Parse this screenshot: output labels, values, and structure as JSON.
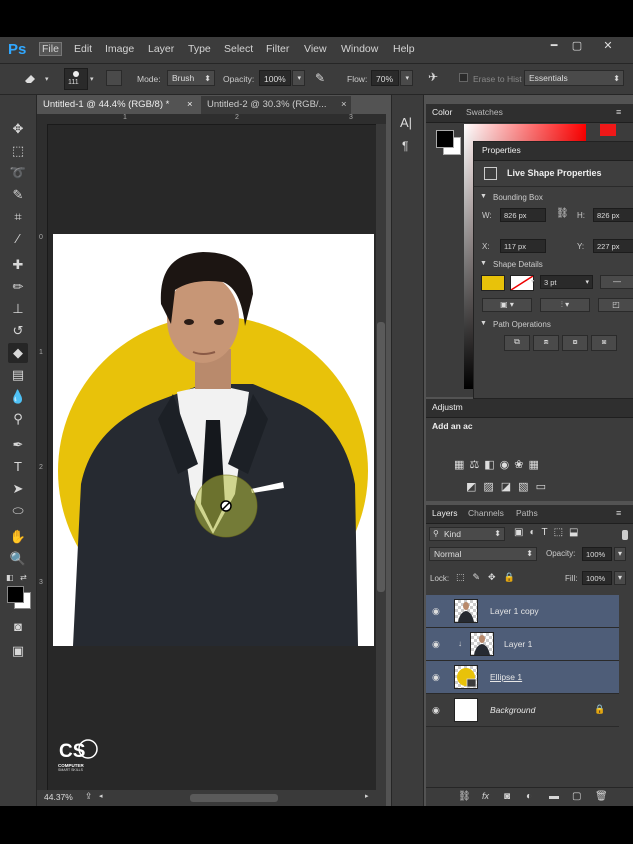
{
  "app": {
    "logo": "Ps"
  },
  "menu": [
    "File",
    "Edit",
    "Image",
    "Layer",
    "Type",
    "Select",
    "Filter",
    "View",
    "Window",
    "Help"
  ],
  "window_buttons": [
    "━",
    "▢",
    "✕"
  ],
  "options": {
    "brush_size": "111",
    "mode_label": "Mode:",
    "mode_value": "Brush",
    "opacity_label": "Opacity:",
    "opacity_value": "100%",
    "flow_label": "Flow:",
    "flow_value": "70%",
    "erase_label": "Erase to Hist",
    "workspace": "Essentials"
  },
  "tabs": [
    {
      "label": "Untitled-1 @ 44.4% (RGB/8) *",
      "close": "×"
    },
    {
      "label": "Untitled-2 @ 30.3% (RGB/...",
      "close": "×"
    }
  ],
  "rulers": {
    "top": [
      "1",
      "2",
      "3"
    ],
    "left": [
      "0",
      "1",
      "2",
      "3"
    ]
  },
  "status": {
    "zoom": "44.37%"
  },
  "watermark": {
    "line1": "COMPUTER",
    "line2": "SMART SKILLS"
  },
  "color_panel": {
    "tab_color": "Color",
    "tab_swatches": "Swatches"
  },
  "properties": {
    "tab": "Properties",
    "title": "Live Shape Properties",
    "bounding_box": "Bounding Box",
    "w_label": "W:",
    "w_value": "826 px",
    "h_label": "H:",
    "h_value": "826 px",
    "x_label": "X:",
    "x_value": "117 px",
    "y_label": "Y:",
    "y_value": "227 px",
    "shape_details": "Shape Details",
    "stroke_width": "3 pt",
    "path_operations": "Path Operations"
  },
  "adjustments": {
    "title": "Adjustm",
    "add": "Add an ac"
  },
  "layers_panel": {
    "tab_layers": "Layers",
    "tab_channels": "Channels",
    "tab_paths": "Paths",
    "kind": "Kind",
    "blend_mode": "Normal",
    "opacity_label": "Opacity:",
    "opacity_value": "100%",
    "lock_label": "Lock:",
    "fill_label": "Fill:",
    "fill_value": "100%",
    "layers": [
      {
        "name": "Layer 1 copy"
      },
      {
        "name": "Layer 1"
      },
      {
        "name": "Ellipse 1"
      },
      {
        "name": "Background"
      }
    ],
    "footer_icons": [
      "link-icon",
      "fx-icon",
      "mask-icon",
      "adjustment-icon",
      "folder-icon",
      "new-layer-icon",
      "trash-icon"
    ]
  },
  "colors": {
    "accent_yellow": "#e8c20a",
    "panel": "#3c3c3c",
    "selection": "#4e5d78",
    "ps_blue": "#31a8ff"
  }
}
